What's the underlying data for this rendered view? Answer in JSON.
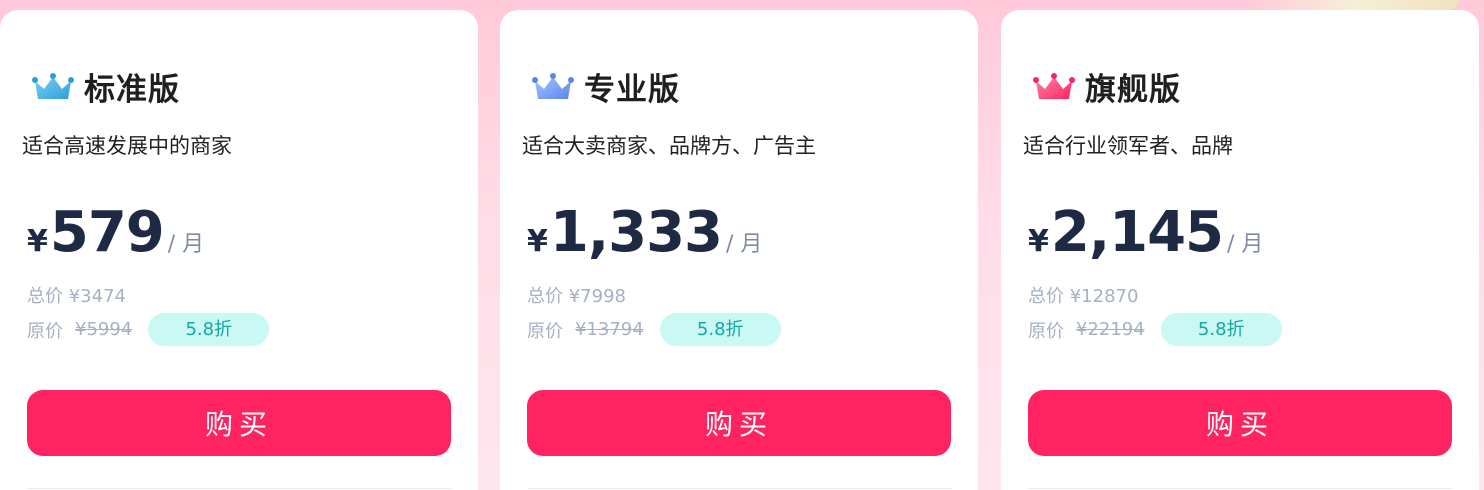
{
  "plans": [
    {
      "name": "标准版",
      "crown_icon": "crown-icon",
      "crown_colors": [
        "#7fd0ef",
        "#2a9fdc"
      ],
      "desc": "适合高速发展中的商家",
      "currency": "¥",
      "price": "579",
      "unit": "/ 月",
      "total_label": "总价",
      "total": "¥3474",
      "orig_label": "原价",
      "orig": "¥5994",
      "discount": "5.8折",
      "buy_label": "购买"
    },
    {
      "name": "专业版",
      "crown_icon": "crown-icon",
      "crown_colors": [
        "#a7c4ff",
        "#5a86ea"
      ],
      "desc": "适合大卖商家、品牌方、广告主",
      "currency": "¥",
      "price": "1,333",
      "unit": "/ 月",
      "total_label": "总价",
      "total": "¥7998",
      "orig_label": "原价",
      "orig": "¥13794",
      "discount": "5.8折",
      "buy_label": "购买"
    },
    {
      "name": "旗舰版",
      "crown_icon": "crown-icon",
      "crown_colors": [
        "#ff84a6",
        "#ff2361"
      ],
      "desc": "适合行业领军者、品牌",
      "currency": "¥",
      "price": "2,145",
      "unit": "/ 月",
      "total_label": "总价",
      "total": "¥12870",
      "orig_label": "原价",
      "orig": "¥22194",
      "discount": "5.8折",
      "buy_label": "购买"
    }
  ],
  "colors": {
    "buy_button": "#ff2361",
    "price": "#1e2a44",
    "discount_bg": "#c9f8f5",
    "discount_text": "#15a8a0",
    "muted": "#a6b0c3"
  }
}
